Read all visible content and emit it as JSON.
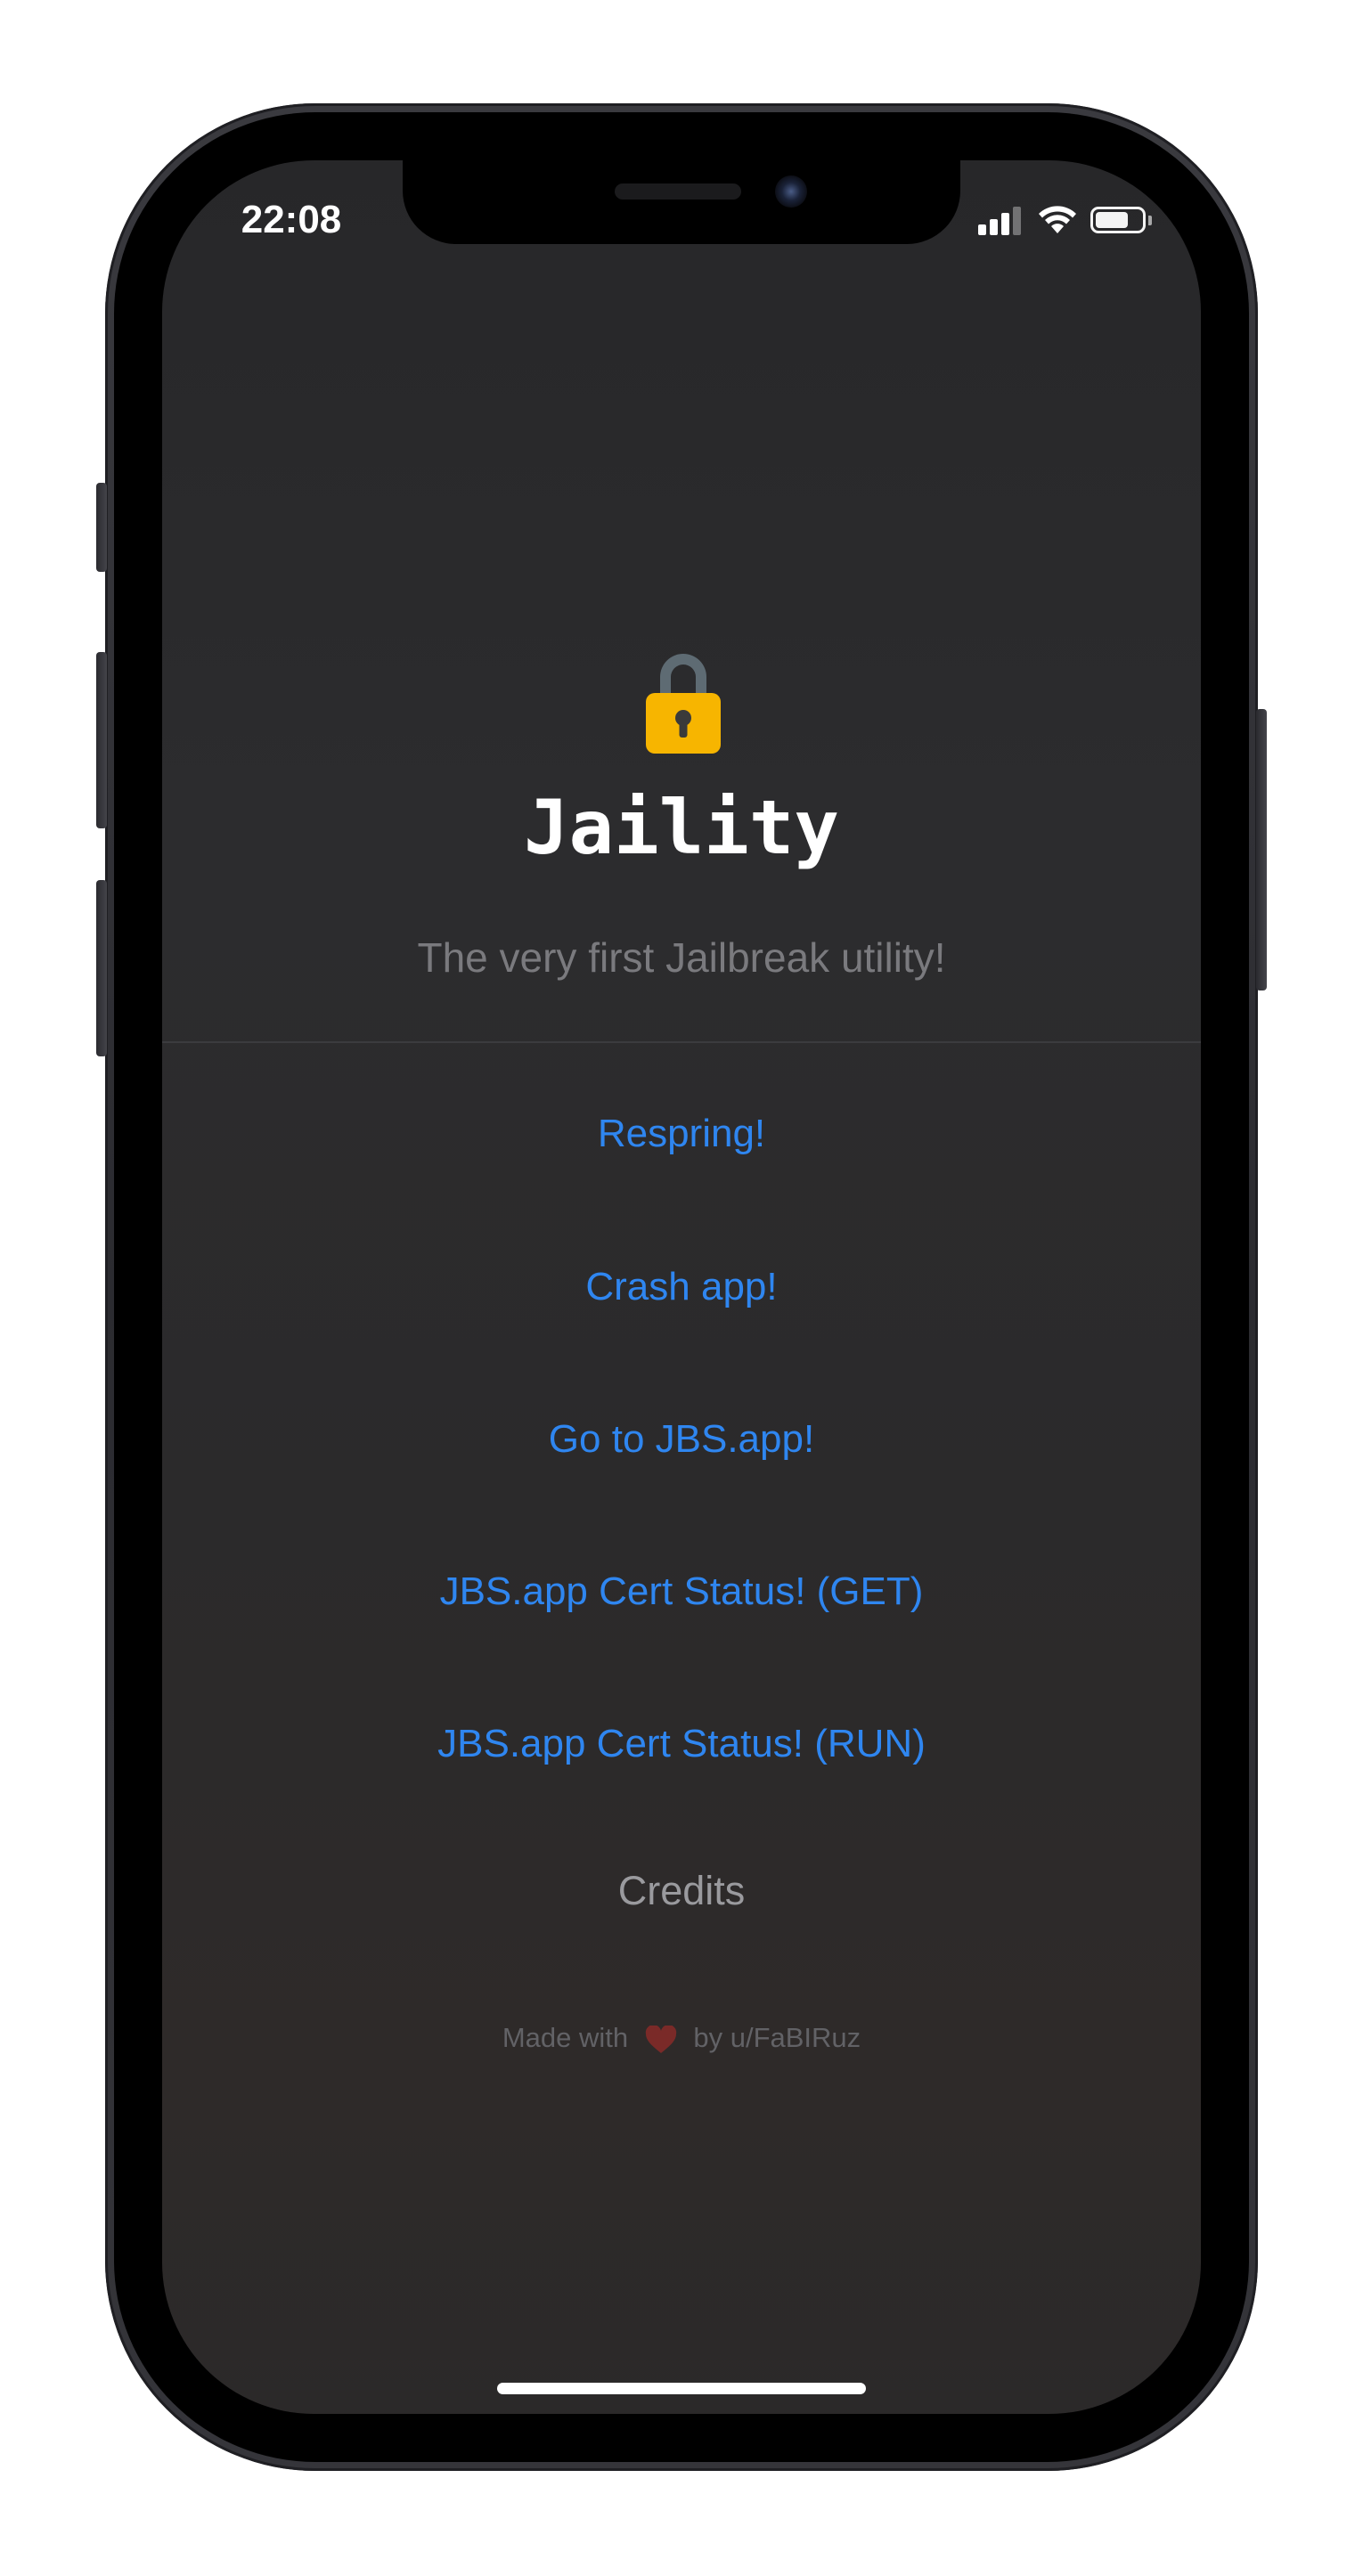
{
  "status_bar": {
    "time": "22:08"
  },
  "app": {
    "icon": "lock-icon",
    "title": "Jaility",
    "subtitle": "The very first Jailbreak utility!"
  },
  "menu": [
    {
      "label": "Respring!"
    },
    {
      "label": "Crash app!"
    },
    {
      "label": "Go to JBS.app!"
    },
    {
      "label": "JBS.app Cert Status! (GET)"
    },
    {
      "label": "JBS.app Cert Status! (RUN)"
    }
  ],
  "credits_label": "Credits",
  "footer": {
    "prefix": "Made with",
    "icon": "heart-icon",
    "suffix": "by u/FaBIRuz"
  },
  "colors": {
    "link": "#2f86f0",
    "background": "#2b2b2d",
    "lock_body": "#f7b500",
    "lock_shackle": "#5e6b73"
  }
}
